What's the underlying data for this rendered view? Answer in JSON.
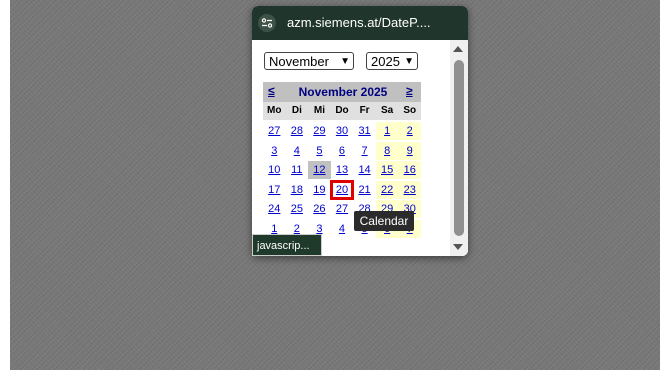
{
  "popup": {
    "url": "azm.siemens.at/DateP....",
    "icon": "settings-sliders-icon"
  },
  "month_select": {
    "value": "November"
  },
  "year_select": {
    "value": "2025"
  },
  "calendar": {
    "prev_label": "≤",
    "next_label": "≥",
    "title": "November 2025",
    "weekdays": [
      "Mo",
      "Di",
      "Mi",
      "Do",
      "Fr",
      "Sa",
      "So"
    ],
    "weeks": [
      [
        "27",
        "28",
        "29",
        "30",
        "31",
        "1",
        "2"
      ],
      [
        "3",
        "4",
        "5",
        "6",
        "7",
        "8",
        "9"
      ],
      [
        "10",
        "11",
        "12",
        "13",
        "14",
        "15",
        "16"
      ],
      [
        "17",
        "18",
        "19",
        "20",
        "21",
        "22",
        "23"
      ],
      [
        "24",
        "25",
        "26",
        "27",
        "28",
        "29",
        "30"
      ],
      [
        "1",
        "2",
        "3",
        "4",
        "5",
        "6",
        "7"
      ]
    ],
    "today": "12",
    "selected": "20"
  },
  "tooltip": "Calendar",
  "status_bar": "javascrip..."
}
